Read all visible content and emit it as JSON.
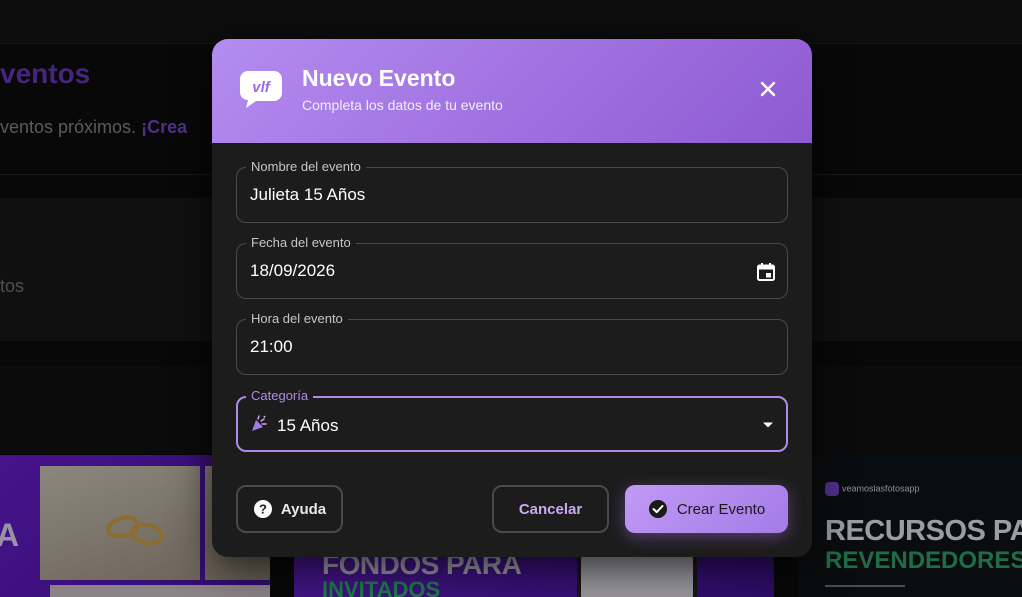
{
  "background": {
    "page_title": "ventos",
    "subtitle_prefix": "ventos próximos.",
    "subtitle_link": "¡Crea",
    "card_text": "tos",
    "promos": [
      {
        "big_letter": "A"
      },
      {
        "title": "FONDOS PARA",
        "subtitle": "INVITADOS"
      },
      {
        "logo": "veamoslasfotosapp",
        "title": "RECURSOS PA",
        "subtitle": "REVENDEDORES"
      }
    ]
  },
  "modal": {
    "title": "Nuevo Evento",
    "subtitle": "Completa los datos de tu evento",
    "fields": {
      "name": {
        "label": "Nombre del evento",
        "value": "Julieta 15 Años"
      },
      "date": {
        "label": "Fecha del evento",
        "value": "18/09/2026"
      },
      "time": {
        "label": "Hora del evento",
        "value": "21:00"
      },
      "category": {
        "label": "Categoría",
        "value": "15 Años",
        "icon": "party-popper-icon"
      }
    },
    "buttons": {
      "help": "Ayuda",
      "cancel": "Cancelar",
      "create": "Crear Evento"
    }
  },
  "colors": {
    "accent": "#b08ae8",
    "header_gradient_start": "#b48cf0",
    "header_gradient_end": "#8e5ad2",
    "modal_bg": "#1c1c1c"
  }
}
